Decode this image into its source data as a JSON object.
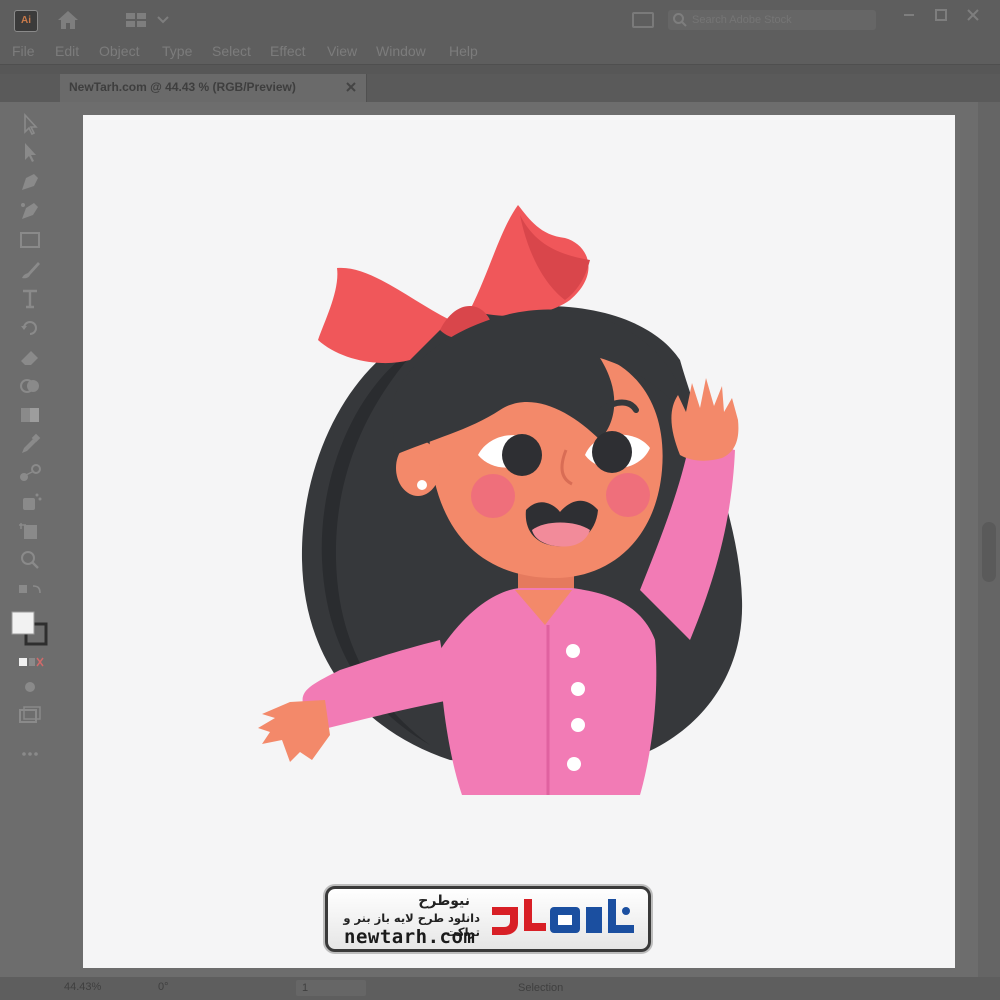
{
  "app": {
    "icon_label": "Ai",
    "colors": {
      "chrome": "#5e5e5e",
      "canvas_bg": "#6d6d6d",
      "artboard": "#f5f5f6",
      "text": "#7c7c7c"
    }
  },
  "search": {
    "placeholder": "Search Adobe Stock"
  },
  "menu": [
    "File",
    "Edit",
    "Object",
    "Type",
    "Select",
    "Effect",
    "View",
    "Window",
    "Help"
  ],
  "document": {
    "tab_title": "NewTarh.com @ 44.43 % (RGB/Preview)"
  },
  "status": {
    "zoom": "44.43%",
    "rotation": "0°",
    "page": "1",
    "selection_mode": "Selection"
  },
  "watermark": {
    "title_fa": "نیوطرح",
    "subtitle_fa": "دانلود طرح لایه باز بنر و تراکت",
    "url": "newtarh.com",
    "logo_fa": "نیوطرح"
  },
  "illustration": {
    "colors": {
      "hair": "#36383b",
      "hair_shadow": "#2a2c2f",
      "skin": "#f3896a",
      "cheek": "#ef6f7b",
      "bow": "#f0575a",
      "bow_dark": "#d9464b",
      "shirt": "#f27bb5",
      "shirt_dark": "#e062a0",
      "button": "#ffffff"
    }
  }
}
